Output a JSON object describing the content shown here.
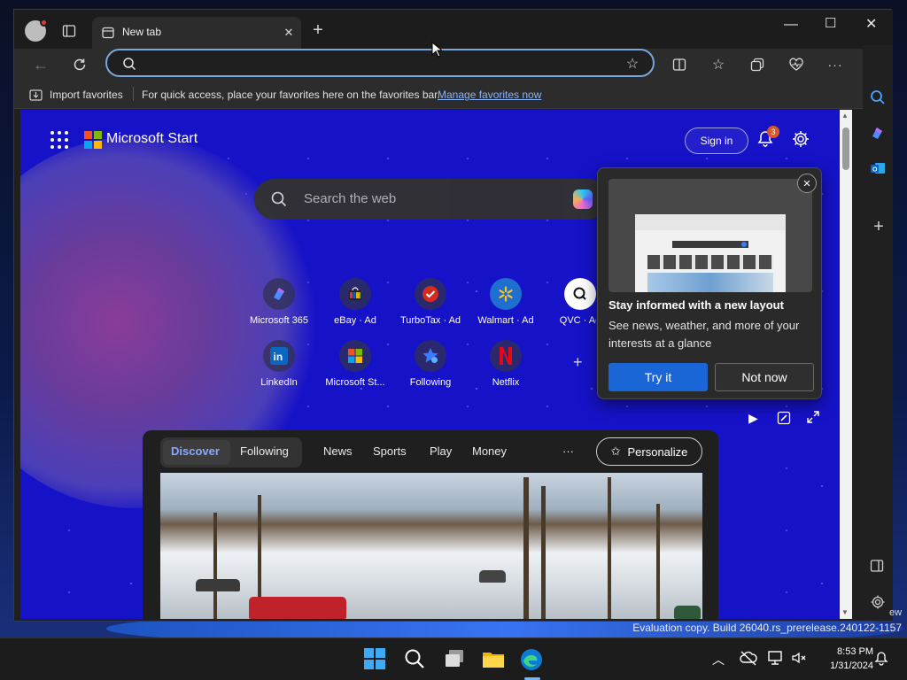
{
  "browser": {
    "tab": {
      "title": "New tab"
    },
    "address": {
      "value": "",
      "placeholder": ""
    },
    "favorites_bar": {
      "import_label": "Import favorites",
      "hint": "For quick access, place your favorites here on the favorites bar.",
      "manage_link": "Manage favorites now"
    }
  },
  "start_page": {
    "brand": "Microsoft Start",
    "sign_in": "Sign in",
    "notifications_count": "3",
    "search_placeholder": "Search the web",
    "tiles": [
      {
        "label": "Microsoft 365",
        "icon": "microsoft-365-icon"
      },
      {
        "label": "eBay · Ad",
        "icon": "ebay-icon"
      },
      {
        "label": "TurboTax · Ad",
        "icon": "turbotax-icon"
      },
      {
        "label": "Walmart · Ad",
        "icon": "walmart-icon"
      },
      {
        "label": "QVC · Ad",
        "icon": "qvc-icon"
      },
      {
        "label": "LinkedIn",
        "icon": "linkedin-icon"
      },
      {
        "label": "Microsoft St...",
        "icon": "microsoft-store-icon"
      },
      {
        "label": "Following",
        "icon": "following-icon"
      },
      {
        "label": "Netflix",
        "icon": "netflix-icon"
      }
    ],
    "popup": {
      "title": "Stay informed with a new layout",
      "body": "See news, weather, and more of your interests at a glance",
      "primary": "Try it",
      "secondary": "Not now"
    },
    "feed_tabs": {
      "discover": "Discover",
      "following": "Following",
      "news": "News",
      "sports": "Sports",
      "play": "Play",
      "money": "Money",
      "more": "···",
      "personalize": "Personalize"
    }
  },
  "taskbar": {
    "watermark": "Evaluation copy. Build 26040.rs_prerelease.240122-1157",
    "clipped_text": "ew",
    "time": "8:53 PM",
    "date": "1/31/2024"
  },
  "colors": {
    "accent": "#1a66d6",
    "start_bg": "#1612c8",
    "notification_badge": "#d9552a"
  }
}
